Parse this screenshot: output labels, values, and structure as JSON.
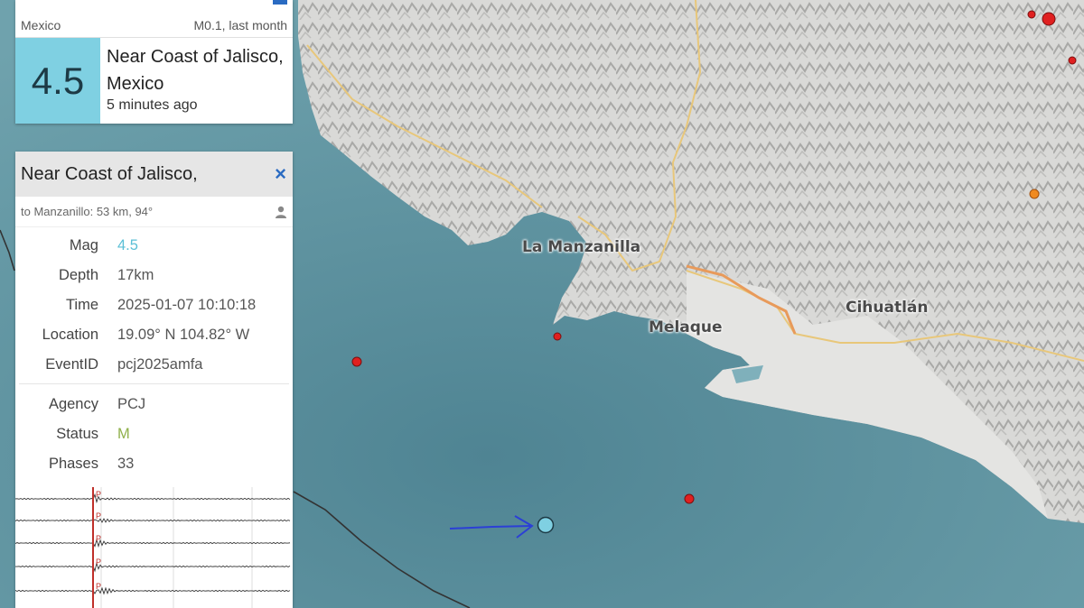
{
  "card": {
    "region": "Mexico",
    "meta": "M0.1, last month",
    "magnitude": "4.5",
    "place": "Near Coast of Jalisco, Mexico",
    "ago": "5 minutes ago"
  },
  "detail": {
    "title": "Near Coast of Jalisco,",
    "close": "×",
    "distance": "to Manzanillo: 53 km, 94°",
    "rows": [
      {
        "key": "Mag",
        "value": "4.5",
        "color": "#5bbfd6"
      },
      {
        "key": "Depth",
        "value": "17km"
      },
      {
        "key": "Time",
        "value": "2025-01-07 10:10:18"
      },
      {
        "key": "Location",
        "value": "19.09° N 104.82° W"
      },
      {
        "key": "EventID",
        "value": "pcj2025amfa"
      }
    ],
    "rows2": [
      {
        "key": "Agency",
        "value": "PCJ"
      },
      {
        "key": "Status",
        "value": "M",
        "color": "#8fb04a"
      },
      {
        "key": "Phases",
        "value": "33"
      }
    ],
    "phase_label": "P"
  },
  "map": {
    "labels": [
      "La Manzanilla",
      "Melaque",
      "Cihuatlán"
    ],
    "colors": {
      "sea": "#5c8f9c",
      "land": "#d4d4d2",
      "quake_recent": "#7fd0e2",
      "quake_old": "#e02020",
      "arrow": "#2b3fd6"
    }
  }
}
